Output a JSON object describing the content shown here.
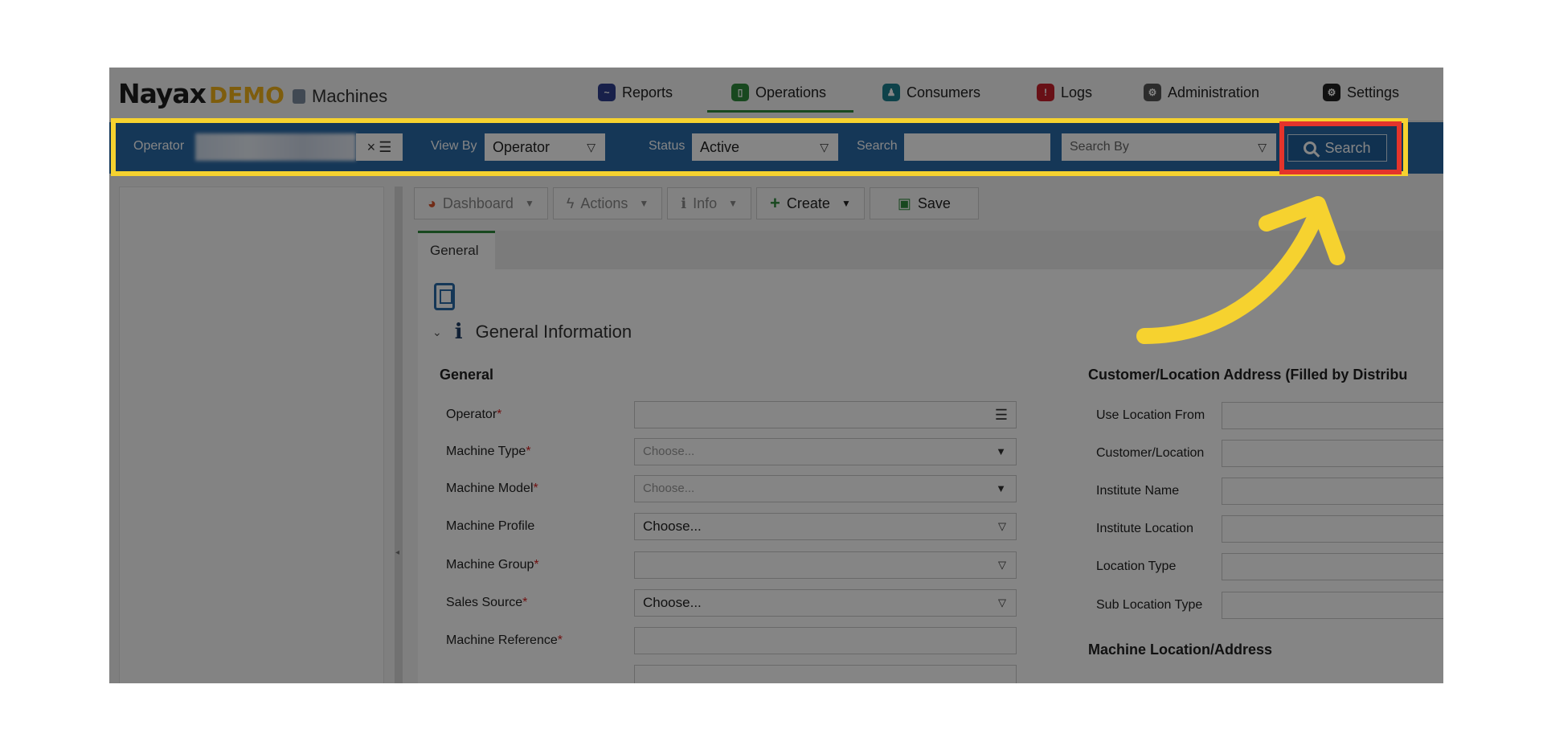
{
  "brand": {
    "name": "Nayax",
    "demo": "DEMO",
    "module": "Machines"
  },
  "nav": [
    {
      "label": "Reports",
      "icon": "reports-icon",
      "color": "#2e3f8f"
    },
    {
      "label": "Operations",
      "icon": "operations-icon",
      "color": "#2e8b3c",
      "active": true
    },
    {
      "label": "Consumers",
      "icon": "consumers-icon",
      "color": "#1b7f8f"
    },
    {
      "label": "Logs",
      "icon": "logs-icon",
      "color": "#c8202b"
    },
    {
      "label": "Administration",
      "icon": "administration-icon",
      "color": "#555555"
    },
    {
      "label": "Settings",
      "icon": "settings-icon",
      "color": "#222222"
    }
  ],
  "filter": {
    "operator_label": "Operator",
    "viewby_label": "View By",
    "viewby_value": "Operator",
    "status_label": "Status",
    "status_value": "Active",
    "search_label": "Search",
    "search_value": "",
    "searchby_placeholder": "Search By",
    "search_button": "Search"
  },
  "toolbar": {
    "dashboard": "Dashboard",
    "actions": "Actions",
    "info": "Info",
    "create": "Create",
    "save": "Save"
  },
  "tabs": {
    "general": "General"
  },
  "section": {
    "title": "General Information"
  },
  "general": {
    "heading": "General",
    "fields": [
      {
        "label": "Operator",
        "required": true,
        "value": "",
        "kind": "list"
      },
      {
        "label": "Machine Type",
        "required": true,
        "value": "Choose...",
        "kind": "placeholder"
      },
      {
        "label": "Machine Model",
        "required": true,
        "value": "Choose...",
        "kind": "placeholder"
      },
      {
        "label": "Machine Profile",
        "required": false,
        "value": "Choose...",
        "kind": "select"
      },
      {
        "label": "Machine Group",
        "required": true,
        "value": "",
        "kind": "select"
      },
      {
        "label": "Sales Source",
        "required": true,
        "value": "Choose...",
        "kind": "select"
      },
      {
        "label": "Machine Reference",
        "required": true,
        "value": "",
        "kind": "text"
      }
    ]
  },
  "customer": {
    "heading": "Customer/Location Address (Filled by Distribu",
    "fields": [
      {
        "label": "Use Location From"
      },
      {
        "label": "Customer/Location"
      },
      {
        "label": "Institute Name"
      },
      {
        "label": "Institute Location"
      },
      {
        "label": "Location Type"
      },
      {
        "label": "Sub Location Type"
      }
    ],
    "next_heading": "Machine Location/Address"
  },
  "colors": {
    "accent": "#2a6aa8",
    "highlight_yellow": "#f6d22f",
    "highlight_red": "#e4342b",
    "required": "#d62020"
  }
}
